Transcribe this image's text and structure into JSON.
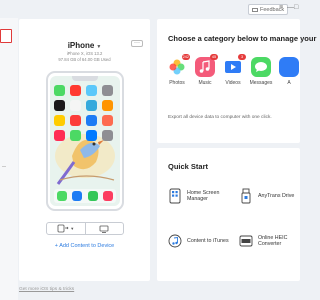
{
  "header": {
    "feedback_label": "Feedback",
    "controls": [
      "≡",
      "—",
      "□"
    ]
  },
  "device": {
    "name": "iPhone",
    "info_line1": "iPhone X, iOS 13.2",
    "info_line2": "97.84 GB of 64.00 GB Used",
    "add_content_label": "+ Add Content to Device"
  },
  "categories": {
    "title": "Choose a category below to manage your",
    "items": [
      {
        "label": "Photos",
        "badge": "242",
        "color": "#ffffff",
        "icon": "photos-icon"
      },
      {
        "label": "Music",
        "badge": "45",
        "color": "#f45b7a",
        "icon": "music-icon"
      },
      {
        "label": "Videos",
        "badge": "3",
        "color": "#ffffff",
        "icon": "videos-icon"
      },
      {
        "label": "Messages",
        "badge": "",
        "color": "#4cd964",
        "icon": "messages-icon"
      },
      {
        "label": "A",
        "badge": "",
        "color": "#2f7cf6",
        "icon": "apps-icon"
      }
    ],
    "export_text": "Export all device data to computer with one click."
  },
  "quick_start": {
    "title": "Quick Start",
    "items": [
      {
        "label": "Home Screen Manager",
        "icon": "home-screen-icon"
      },
      {
        "label": "AnyTrans Drive",
        "icon": "usb-drive-icon"
      },
      {
        "label": "Content to iTunes",
        "icon": "itunes-icon"
      },
      {
        "label": "Online HEIC Converter",
        "icon": "heic-converter-icon"
      }
    ]
  },
  "footer": {
    "link_text": "Get more iOS tips & tricks"
  },
  "colors": {
    "accent": "#2b7be0",
    "selection": "#e03a3a"
  }
}
